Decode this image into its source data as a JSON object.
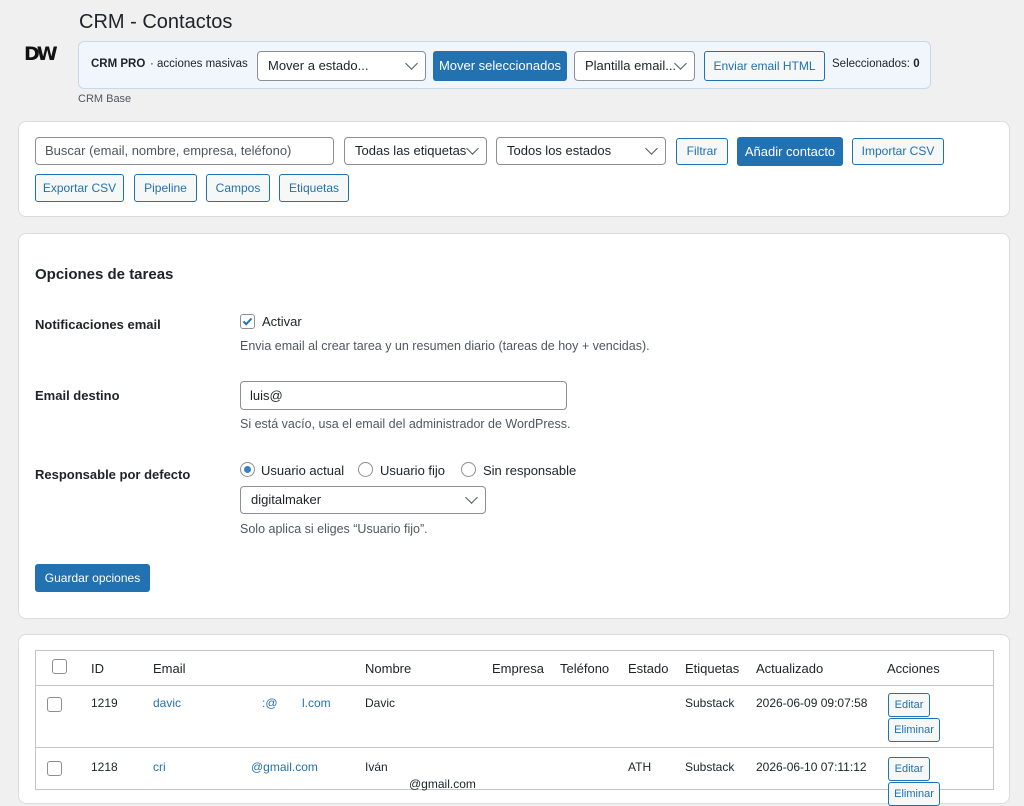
{
  "header": {
    "logo": "DW",
    "title": "CRM - Contactos",
    "subtitle": "CRM Base"
  },
  "bulk": {
    "brand": "CRM PRO",
    "label": "· acciones masivas",
    "move_select": "Mover a estado...",
    "move_button": "Mover seleccionados",
    "template_select": "Plantilla email...",
    "send_button": "Enviar email HTML",
    "selected_label": "Seleccionados:",
    "selected_count": "0"
  },
  "filters": {
    "search_placeholder": "Buscar (email, nombre, empresa, teléfono)",
    "tags_select": "Todas las etiquetas",
    "states_select": "Todos los estados",
    "filter_button": "Filtrar",
    "add_button": "Añadir contacto",
    "import_button": "Importar CSV",
    "export_button": "Exportar CSV",
    "pipeline_button": "Pipeline",
    "fields_button": "Campos",
    "tags_button": "Etiquetas"
  },
  "tasks": {
    "heading": "Opciones de tareas",
    "notif_label": "Notificaciones email",
    "notif_check": "Activar",
    "notif_checked": true,
    "notif_desc": "Envia email al crear tarea y un resumen diario (tareas de hoy + vencidas).",
    "email_label": "Email destino",
    "email_value": "luis@",
    "email_desc": "Si está vacío, usa el email del administrador de WordPress.",
    "resp_label": "Responsable por defecto",
    "resp_options": [
      "Usuario actual",
      "Usuario fijo",
      "Sin responsable"
    ],
    "resp_selected": "Usuario actual",
    "user_select": "digitalmaker",
    "user_desc": "Solo aplica si eliges “Usuario fijo”.",
    "save_button": "Guardar opciones"
  },
  "table": {
    "columns": [
      "ID",
      "Email",
      "Nombre",
      "Empresa",
      "Teléfono",
      "Estado",
      "Etiquetas",
      "Actualizado",
      "Acciones"
    ],
    "rows": [
      {
        "id": "1219",
        "email_a": "davic",
        "email_b": ":@",
        "email_c": "l.com",
        "name": "Davic",
        "empresa": "",
        "telefono": "",
        "estado": "",
        "etiquetas": "Substack",
        "actualizado": "2026-06-09 09:07:58"
      },
      {
        "id": "1218",
        "email_a": "cri",
        "email_b": "@gmail.com",
        "email_c": "",
        "name": "Iván",
        "name2": "@gmail.com",
        "empresa": "",
        "telefono": "",
        "estado": "ATH",
        "etiquetas": "Substack",
        "actualizado": "2026-06-10 07:11:12"
      }
    ],
    "edit_label": "Editar",
    "delete_label": "Eliminar"
  }
}
